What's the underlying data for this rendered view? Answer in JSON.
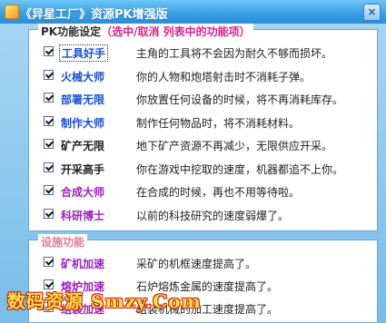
{
  "window": {
    "title": "《异星工厂》资源PK增强版",
    "close_glyph": "×"
  },
  "pk_section": {
    "legend_prefix": "PK功能设定",
    "legend_hint": "（选中/取消 列表中的功能项）",
    "items": [
      {
        "name": "工具好手",
        "desc": "主角的工具将不会因为耐久不够而损坏。",
        "checked": true,
        "color": "#1a4fd6"
      },
      {
        "name": "火械大师",
        "desc": "你的人物和炮塔射击时不消耗子弹。",
        "checked": true,
        "color": "#1a4fd6"
      },
      {
        "name": "部署无限",
        "desc": "你放置任何设备的时候，将不再消耗库存。",
        "checked": true,
        "color": "#1a4fd6"
      },
      {
        "name": "制作大师",
        "desc": "制作任何物品时，将不消耗材料。",
        "checked": true,
        "color": "#1a4fd6"
      },
      {
        "name": "矿产无限",
        "desc": "地下矿产资源不再减少，无限供应开采。",
        "checked": true,
        "color": "#222222"
      },
      {
        "name": "开采高手",
        "desc": "你在游戏中挖取的速度，机器都追不上你。",
        "checked": true,
        "color": "#222222"
      },
      {
        "name": "合成大师",
        "desc": "在合成的时候，再也不用等待啦。",
        "checked": true,
        "color": "#a020c0"
      },
      {
        "name": "科研博士",
        "desc": "以前的科技研究的速度弱爆了。",
        "checked": true,
        "color": "#a020c0"
      }
    ]
  },
  "facility_section": {
    "legend": "设施功能",
    "items": [
      {
        "name": "矿机加速",
        "desc": "采矿的机框速度提高了。",
        "checked": true,
        "color": "#a020c0"
      },
      {
        "name": "熔炉加速",
        "desc": "石炉熔炼金属的速度提高了。",
        "checked": true,
        "color": "#a020c0"
      },
      {
        "name": "组装加速",
        "desc": "组装机械的加工速度提高了。",
        "checked": true,
        "color": "#a020c0"
      }
    ]
  },
  "watermark": "数码资源 Smzy.Com"
}
